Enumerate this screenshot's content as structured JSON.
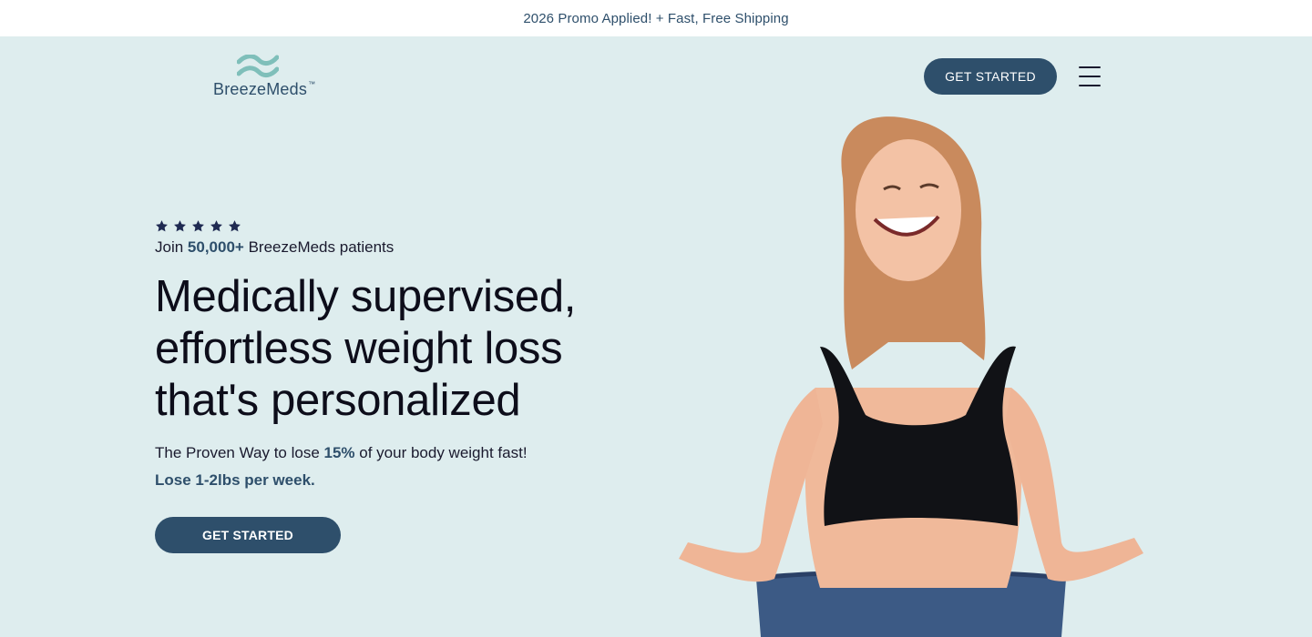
{
  "promo": {
    "text": "2026 Promo Applied! + Fast, Free Shipping"
  },
  "header": {
    "logo_text": "BreezeMeds",
    "logo_tm": "™",
    "cta_label": "GET STARTED",
    "menu_icon": "hamburger-menu-icon"
  },
  "hero": {
    "rating": {
      "stars": 5,
      "icon": "star-icon"
    },
    "join_prefix": "Join ",
    "join_count": "50,000+",
    "join_suffix": " BreezeMeds patients",
    "headline": "Medically supervised, effortless weight loss that's personalized",
    "sub_prefix": "The Proven Way to lose ",
    "sub_percent": "15%",
    "sub_suffix": " of your body weight fast!",
    "sub_highlight": "Lose 1-2lbs per week.",
    "cta_label": "GET STARTED",
    "image_icon": "woman-photo"
  },
  "colors": {
    "page_bg": "#deedee",
    "brand_navy": "#2e4f6b",
    "logo_teal": "#7fbfba",
    "heading": "#0d0d1a"
  }
}
